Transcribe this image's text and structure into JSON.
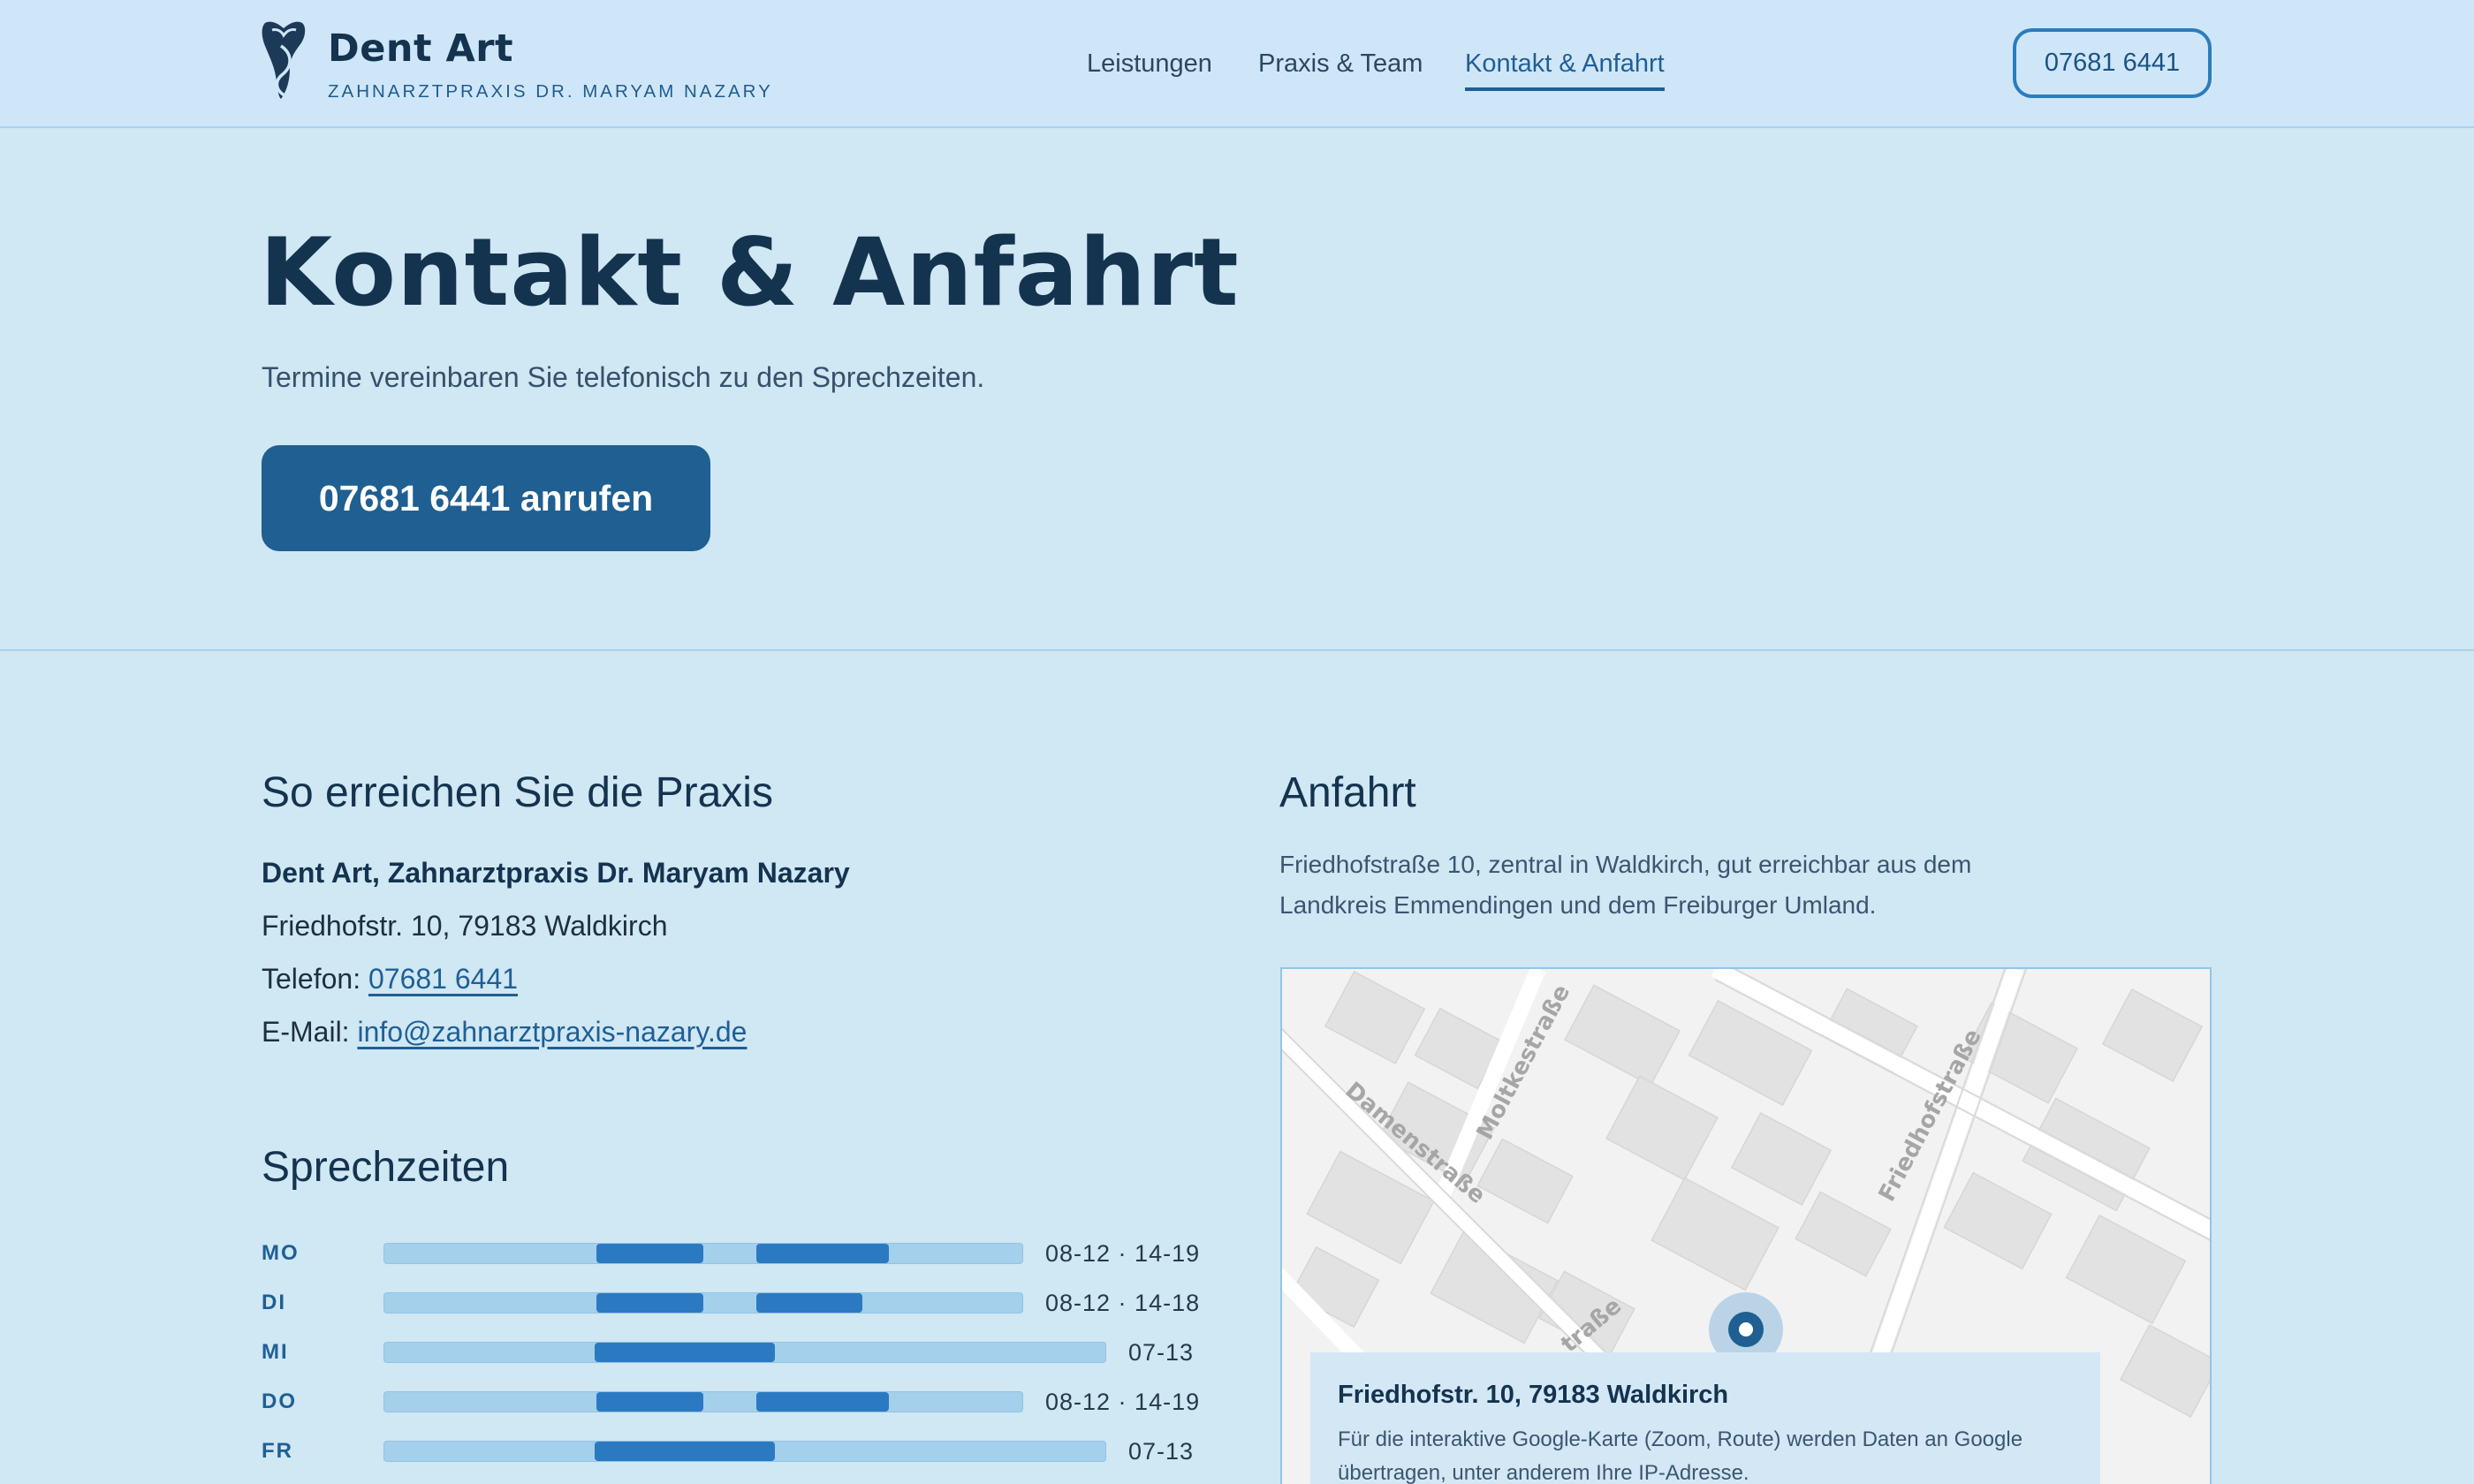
{
  "header": {
    "brand_name": "Dent Art",
    "brand_subtitle": "ZAHNARZTPRAXIS DR. MARYAM NAZARY",
    "nav": [
      {
        "label": "Leistungen",
        "active": false
      },
      {
        "label": "Praxis & Team",
        "active": false
      },
      {
        "label": "Kontakt & Anfahrt",
        "active": true
      }
    ],
    "phone_button": "07681 6441"
  },
  "hero": {
    "title": "Kontakt & Anfahrt",
    "subtitle": "Termine vereinbaren Sie telefonisch zu den Sprechzeiten.",
    "cta": "07681 6441 anrufen"
  },
  "contact": {
    "heading": "So erreichen Sie die Praxis",
    "name": "Dent Art, Zahnarztpraxis Dr. Maryam Nazary",
    "address": "Friedhofstr. 10, 79183 Waldkirch",
    "phone_label": "Telefon:",
    "phone": "07681 6441",
    "email_label": "E-Mail:",
    "email": "info@zahnarztpraxis-nazary.de"
  },
  "hours": {
    "heading": "Sprechzeiten",
    "rows": [
      {
        "day": "MO",
        "text": "08-12 · 14-19"
      },
      {
        "day": "DI",
        "text": "08-12 · 14-18"
      },
      {
        "day": "MI",
        "text": "07-13"
      },
      {
        "day": "DO",
        "text": "08-12 · 14-19"
      },
      {
        "day": "FR",
        "text": "07-13"
      }
    ]
  },
  "directions": {
    "heading": "Anfahrt",
    "text": "Friedhofstraße 10, zentral in Waldkirch, gut erreichbar aus dem Landkreis Emmendingen und dem Freiburger Umland.",
    "map": {
      "street_labels": [
        "Damenstraße",
        "Moltkestraße",
        "Friedhofstraße",
        "traße"
      ],
      "card_title": "Friedhofstr. 10, 79183 Waldkirch",
      "card_text": "Für die interaktive Google-Karte (Zoom, Route) werden Daten an Google übertragen, unter anderem Ihre IP-Adresse."
    }
  },
  "colors": {
    "page_bg": "#d0e7f4",
    "header_bg": "#cfe6f8",
    "primary": "#1f5f91",
    "accent": "#2b7ac1",
    "track": "#a4d0ec",
    "text_dark": "#14334f"
  },
  "icons": [
    "tooth-logo-icon",
    "map-pin-icon"
  ]
}
